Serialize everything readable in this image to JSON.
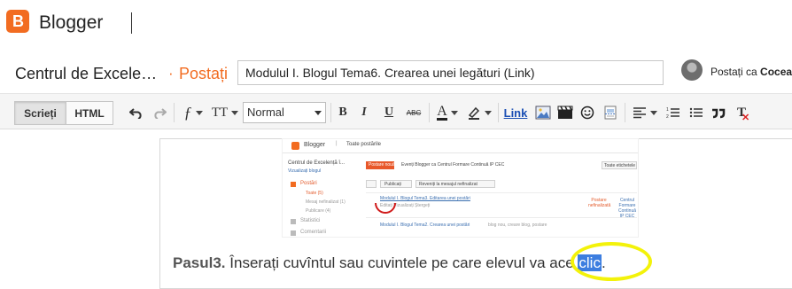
{
  "app": {
    "name": "Blogger",
    "logo_letter": "B",
    "brand_color": "#f26c21"
  },
  "post_header": {
    "blog_name": "Centrul de Excele…",
    "separator": "·",
    "section": "Postați",
    "title_value": "Modulul I. Blogul Tema6. Crearea unei legături (Link)",
    "posting_as_label": "Postați ca",
    "posting_as_user": "Coceas"
  },
  "toolbar": {
    "mode_write": "Scrieți",
    "mode_html": "HTML",
    "undo_icon": "undo-icon",
    "redo_icon": "redo-icon",
    "font_glyph": "ƒ",
    "font_size_glyph": "TT",
    "format_value": "Normal",
    "bold": "B",
    "italic": "I",
    "underline": "U",
    "strike": "ABC",
    "text_color_glyph": "A",
    "link": "Link",
    "clear_format_glyph": "T"
  },
  "embedded_image": {
    "brand": "Blogger",
    "all_posts": "Toate postările",
    "blog_name": "Centrul de Excelență î...",
    "view_blog": "Vizualizați blogul",
    "new_post": "Postare nouă",
    "events_text": "Evenți Blogger ca Centrul Formare Continuă IP CEC",
    "all_labels": "Toate etichetele",
    "menu_posts": "Postări",
    "menu_all": "Toate (5)",
    "menu_drafts": "Mesaj nefinalizat (1)",
    "menu_published": "Publicare (4)",
    "menu_stats": "Statistici",
    "menu_comments": "Comentarii",
    "btn_publish": "Publicați",
    "btn_revert": "Reveniți la mesajul nefinalizat",
    "post1_title": "Modulul I. Blogul Tema3. Editarea unei postări",
    "post1_actions": "Editați  Vizualizați  Ștergeți",
    "post1_status": "Postare nefinalizată",
    "post1_author": "Centrul Formare Continuă IP CEC",
    "post2_title": "Modulul I. Blogul Tema2. Crearea unei postări",
    "post2_meta": "blog nou, creare blog, postare"
  },
  "paragraph": {
    "step_label": "Pasul3.",
    "text": " Înserați cuvîntul sau cuvintele pe care elevul va ",
    "word_plain": "ace ",
    "word_selected": "clic",
    "suffix": "."
  },
  "colors": {
    "selection": "#3d7ee0",
    "highlight_ring": "#f3f20a",
    "scribble": "#d01a1a"
  }
}
